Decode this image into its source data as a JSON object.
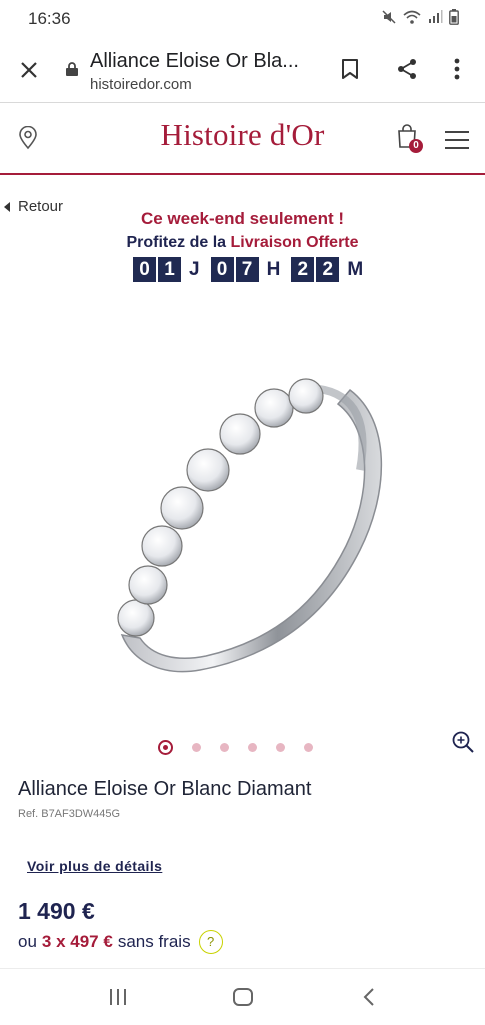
{
  "status_bar": {
    "time": "16:36",
    "icons": [
      "mute-icon",
      "wifi-icon",
      "signal-icon",
      "battery-icon"
    ]
  },
  "browser": {
    "page_title": "Alliance Eloise Or Bla...",
    "url": "histoiredor.com",
    "icons": [
      "close-icon",
      "lock-icon",
      "bookmark-icon",
      "share-icon",
      "more-icon"
    ]
  },
  "site_header": {
    "brand": "Histoire d'Or",
    "cart_count": "0",
    "icons": [
      "store-locator-icon",
      "cart-icon",
      "menu-icon"
    ]
  },
  "back": {
    "label": "Retour"
  },
  "promo": {
    "title": "Ce week-end seulement !",
    "line_prefix": "Profitez de la",
    "line_accent": "Livraison Offerte",
    "countdown": {
      "days": [
        "0",
        "1"
      ],
      "days_unit": "J",
      "hours": [
        "0",
        "7"
      ],
      "hours_unit": "H",
      "minutes": [
        "2",
        "2"
      ],
      "minutes_unit": "M"
    }
  },
  "gallery": {
    "total": 6,
    "active_index": 0
  },
  "product": {
    "name": "Alliance Eloise Or Blanc Diamant",
    "ref": "Ref. B7AF3DW445G",
    "details_link": "Voir plus de détails",
    "price": "1 490 €",
    "installments_prefix": "ou",
    "installments_accent": "3 x 497 €",
    "installments_suffix": "sans frais",
    "help": "?"
  },
  "colors": {
    "brand": "#a51c3a",
    "navy": "#1f2450",
    "countdown_bg": "#202a52"
  }
}
